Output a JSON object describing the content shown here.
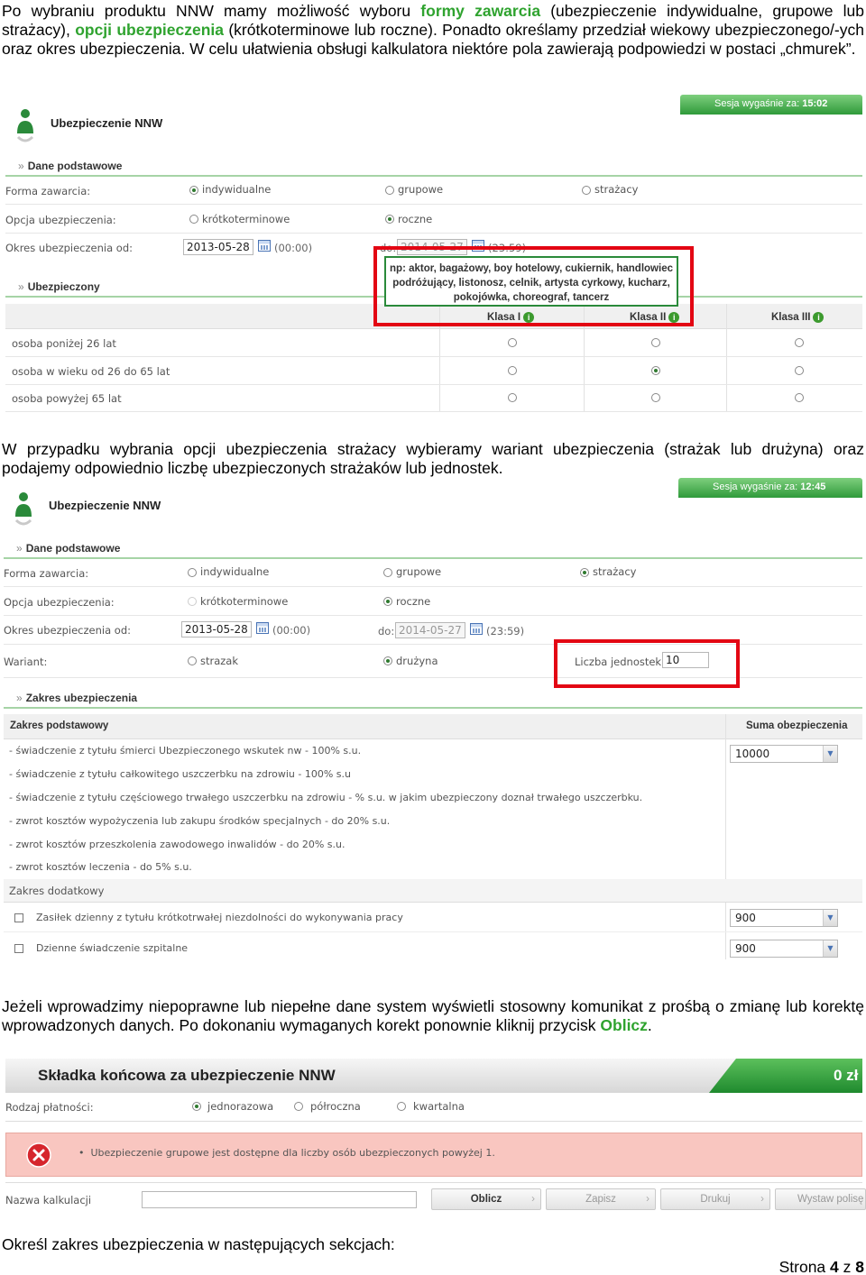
{
  "intro": {
    "p1": "Po wybraniu produktu NNW mamy możliwość wyboru ",
    "p1_green1": "formy zawarcia",
    "p2": " (ubezpieczenie indywidualne, grupowe lub strażacy), ",
    "p2_green2": "opcji ubezpieczenia",
    "p3": " (krótkoterminowe lub roczne). Ponadto określamy przedział wiekowy ubezpieczonego/-ych oraz okres ubezpieczenia. W celu ułatwienia obsługi kalkulatora niektóre pola zawierają podpowiedzi w postaci „chmurek”."
  },
  "shot1": {
    "app_title": "Ubezpieczenie NNW",
    "session_label": "Sesja wygaśnie za:",
    "session_time": "15:02",
    "section_basic": "Dane podstawowe",
    "forma_label": "Forma zawarcia:",
    "forma_options": [
      "indywidualne",
      "grupowe",
      "strażacy"
    ],
    "opcja_label": "Opcja ubezpieczenia:",
    "opcja_options": [
      "krótkoterminowe",
      "roczne"
    ],
    "okres_label": "Okres ubezpieczenia od:",
    "date_from": "2013-05-28",
    "time_from": "(00:00)",
    "do_label": "do:",
    "date_to": "2014-05-27",
    "time_to": "(23:59)",
    "tooltip": "np: aktor, bagażowy, boy hotelowy, cukiernik, handlowiec podróżujący, listonosz, celnik, artysta cyrkowy, kucharz, pokojówka, choreograf, tancerz",
    "section_insured": "Ubezpieczony",
    "klasy": [
      "Klasa I",
      "Klasa II",
      "Klasa III"
    ],
    "age_rows": [
      "osoba poniżej 26 lat",
      "osoba w wieku od 26 do 65 lat",
      "osoba powyżej 65 lat"
    ]
  },
  "mid": {
    "text": "W przypadku wybrania opcji ubezpieczenia strażacy wybieramy wariant ubezpieczenia (strażak lub drużyna) oraz podajemy odpowiednio liczbę ubezpieczonych strażaków lub jednostek."
  },
  "shot2": {
    "app_title": "Ubezpieczenie NNW",
    "session_label": "Sesja wygaśnie za:",
    "session_time": "12:45",
    "section_basic": "Dane podstawowe",
    "forma_label": "Forma zawarcia:",
    "forma_options": [
      "indywidualne",
      "grupowe",
      "strażacy"
    ],
    "opcja_label": "Opcja ubezpieczenia:",
    "opcja_options": [
      "krótkoterminowe",
      "roczne"
    ],
    "okres_label": "Okres ubezpieczenia od:",
    "date_from": "2013-05-28",
    "time_from": "(00:00)",
    "do_label": "do:",
    "date_to": "2014-05-27",
    "time_to": "(23:59)",
    "wariant_label": "Wariant:",
    "wariant_options": [
      "strazak",
      "drużyna"
    ],
    "liczba_label": "Liczba jednostek",
    "liczba_value": "10",
    "section_scope": "Zakres ubezpieczenia",
    "zakres_podstawowy": "Zakres podstawowy",
    "suma_label": "Suma obezpieczenia",
    "suma_value": "10000",
    "lines": [
      "- świadczenie z tytułu śmierci Ubezpieczonego wskutek nw - 100% s.u.",
      "- świadczenie z tytułu całkowitego uszczerbku na zdrowiu - 100% s.u",
      "- świadczenie z tytułu częściowego trwałego uszczerbku na zdrowiu - % s.u. w jakim ubezpieczony doznał trwałego uszczerbku.",
      "- zwrot kosztów wypożyczenia lub zakupu środków specjalnych - do 20% s.u.",
      "- zwrot kosztów przeszkolenia zawodowego inwalidów - do 20% s.u.",
      "- zwrot kosztów leczenia - do 5% s.u."
    ],
    "zakres_dodatkowy": "Zakres dodatkowy",
    "extra": [
      {
        "label": "Zasiłek dzienny z tytułu krótkotrwałej niezdolności do wykonywania pracy",
        "value": "900"
      },
      {
        "label": "Dzienne świadczenie szpitalne",
        "value": "900"
      }
    ]
  },
  "mid2": {
    "text": "Jeżeli wprowadzimy niepoprawne lub niepełne dane system wyświetli stosowny komunikat z prośbą o zmianę lub korektę wprowadzonych danych. Po dokonaniu wymaganych korekt ponownie kliknij przycisk ",
    "oblicz": "Oblicz",
    "dot": "."
  },
  "shot3": {
    "title": "Składka końcowa za ubezpieczenie NNW",
    "amount": "0 zł",
    "rodzaj_label": "Rodzaj płatności:",
    "rodzaj_options": [
      "jednorazowa",
      "półroczna",
      "kwartalna"
    ],
    "error": "Ubezpieczenie grupowe jest dostępne dla liczby osób ubezpieczonych powyżej 1.",
    "nazwa_label": "Nazwa kalkulacji",
    "buttons": [
      "Oblicz",
      "Zapisz",
      "Drukuj",
      "Wystaw polisę"
    ]
  },
  "outro": "Określ zakres ubezpieczenia w następujących sekcjach:",
  "footer": {
    "prefix": "Strona ",
    "page": "4",
    "sep": " z ",
    "total": "8"
  },
  "colors": {
    "accent_green": "#2fa32f",
    "error_red": "#e30613",
    "error_bg": "#f9c6c0"
  }
}
